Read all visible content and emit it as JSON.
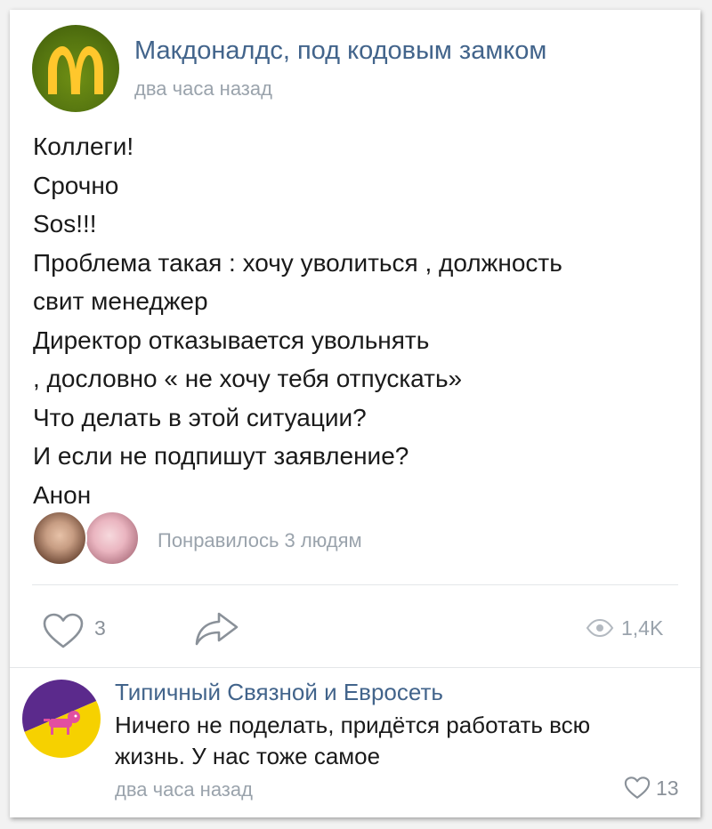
{
  "post": {
    "author": "Макдоналдс, под кодовым замком",
    "time": "два часа назад",
    "lines": [
      "Коллеги!",
      "Срочно",
      "Sos!!!",
      "Проблема такая : хочу уволиться , должность",
      "свит менеджер",
      "Директор отказывается увольнять",
      ", дословно « не хочу тебя отпускать»",
      "Что делать в этой ситуации?",
      "И если не подпишут заявление?",
      "Анон"
    ],
    "liked_by": "Понравилось 3 людям",
    "likes_count": "3",
    "views_count": "1,4K",
    "avatar_colors": {
      "background": "#557510",
      "logo": "#ffc72c"
    }
  },
  "comment": {
    "author": "Типичный Связной и Евросеть",
    "lines": [
      "Ничего не поделать, придётся работать всю",
      "жизнь. У нас тоже самое"
    ],
    "time": "два часа назад",
    "likes_count": "13",
    "avatar_colors": {
      "top": "#5b2a8c",
      "bottom": "#f6d100"
    }
  },
  "colors": {
    "link": "#42648b",
    "muted": "#9aa3ac",
    "icon": "#8a9199",
    "text": "#1a1a1a"
  },
  "icons": [
    "heart-icon",
    "share-icon",
    "eye-icon",
    "heart-icon"
  ]
}
